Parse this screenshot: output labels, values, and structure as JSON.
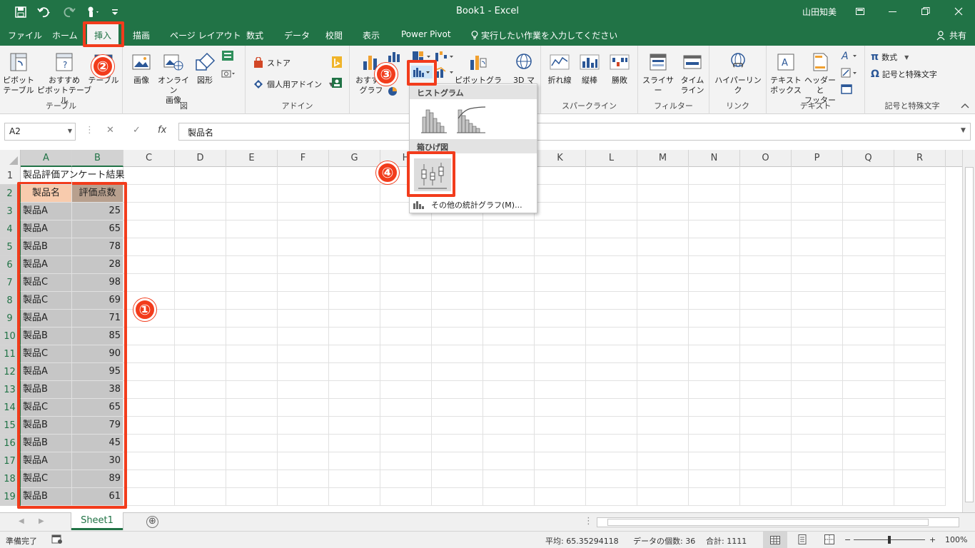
{
  "window": {
    "title": "Book1  -  Excel",
    "user": "山田知美"
  },
  "tabs": [
    {
      "label": "ファイル"
    },
    {
      "label": "ホーム"
    },
    {
      "label": "挿入"
    },
    {
      "label": "描画"
    },
    {
      "label": "ページ レイアウト"
    },
    {
      "label": "数式"
    },
    {
      "label": "データ"
    },
    {
      "label": "校閲"
    },
    {
      "label": "表示"
    },
    {
      "label": "Power Pivot"
    },
    {
      "label": "実行したい作業を入力してください"
    }
  ],
  "share_label": "共有",
  "ribbon": {
    "groups": {
      "table": "テーブル",
      "figure": "図",
      "addin": "アドイン",
      "sparkline": "スパークライン",
      "filter": "フィルター",
      "link": "リンク",
      "text": "テキスト",
      "symbols": "記号と特殊文字"
    },
    "buttons": {
      "pivot_table": "ピボット\nテーブル",
      "recommended_pivot": "おすすめ\nピボットテーブル",
      "table": "テーブル",
      "image": "画像",
      "online_image": "オンライン\n画像",
      "shapes": "図形",
      "store": "ストア",
      "my_addins": "個人用アドイン",
      "recommended_chart": "おすすめ\nグラフ",
      "pivot_chart": "ピボットグラフ",
      "map_3d": "3D マ",
      "line": "折れ線",
      "column": "縦棒",
      "winloss": "勝敗",
      "slicer": "スライサー",
      "timeline": "タイム\nライン",
      "hyperlink": "ハイパーリンク",
      "textbox": "テキスト\nボックス",
      "header_footer": "ヘッダーと\nフッター",
      "equation": "数式",
      "symbol": "記号と特殊文字"
    }
  },
  "formula_bar": {
    "name_box": "A2",
    "cancel": "✕",
    "enter": "✓",
    "fx": "fx",
    "content": "製品名"
  },
  "columns": [
    "A",
    "B",
    "C",
    "D",
    "E",
    "F",
    "G",
    "H",
    "I",
    "J",
    "K",
    "L",
    "M",
    "N",
    "O",
    "P",
    "Q",
    "R"
  ],
  "rows": [
    {
      "n": "1",
      "a": "製品評価アンケート結果",
      "b": ""
    },
    {
      "n": "2",
      "a": "製品名",
      "b": "評価点数"
    },
    {
      "n": "3",
      "a": "製品A",
      "b": "25"
    },
    {
      "n": "4",
      "a": "製品A",
      "b": "65"
    },
    {
      "n": "5",
      "a": "製品B",
      "b": "78"
    },
    {
      "n": "6",
      "a": "製品A",
      "b": "28"
    },
    {
      "n": "7",
      "a": "製品C",
      "b": "98"
    },
    {
      "n": "8",
      "a": "製品C",
      "b": "69"
    },
    {
      "n": "9",
      "a": "製品A",
      "b": "71"
    },
    {
      "n": "10",
      "a": "製品B",
      "b": "85"
    },
    {
      "n": "11",
      "a": "製品C",
      "b": "90"
    },
    {
      "n": "12",
      "a": "製品A",
      "b": "95"
    },
    {
      "n": "13",
      "a": "製品B",
      "b": "38"
    },
    {
      "n": "14",
      "a": "製品C",
      "b": "65"
    },
    {
      "n": "15",
      "a": "製品B",
      "b": "79"
    },
    {
      "n": "16",
      "a": "製品B",
      "b": "45"
    },
    {
      "n": "17",
      "a": "製品A",
      "b": "30"
    },
    {
      "n": "18",
      "a": "製品C",
      "b": "89"
    },
    {
      "n": "19",
      "a": "製品B",
      "b": "61"
    }
  ],
  "dropdown": {
    "histogram_header": "ヒストグラム",
    "boxwhisker_header": "箱ひげ図",
    "more_charts": "その他の統計グラフ(M)..."
  },
  "annotations": {
    "step1": "①",
    "step2": "②",
    "step3": "③",
    "step4": "④",
    "color": "#f23c1c"
  },
  "sheet": {
    "tab": "Sheet1",
    "add": "⊕"
  },
  "status": {
    "ready": "準備完了",
    "average": "平均: 65.35294118",
    "count": "データの個数: 36",
    "sum": "合計: 1111",
    "zoom": "100%"
  },
  "colors": {
    "excel_green": "#217346",
    "header_a": "#f8cbad",
    "header_b": "#b8a08e",
    "selection": "#c6c6c6"
  }
}
